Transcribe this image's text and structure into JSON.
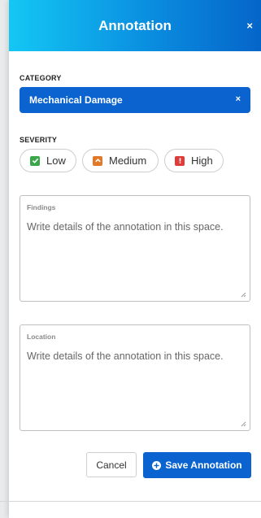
{
  "header": {
    "title": "Annotation",
    "close_glyph": "×"
  },
  "category": {
    "label": "CATEGORY",
    "selected": "Mechanical Damage",
    "clear_glyph": "×"
  },
  "severity": {
    "label": "SEVERITY",
    "options": [
      {
        "label": "Low",
        "icon": "check-icon",
        "color": "#3aa84a"
      },
      {
        "label": "Medium",
        "icon": "chevron-up-icon",
        "color": "#e07a2a"
      },
      {
        "label": "High",
        "icon": "exclamation-icon",
        "color": "#e03b3b"
      }
    ]
  },
  "findings": {
    "label": "Findings",
    "placeholder": "Write details of the annotation in this space."
  },
  "location": {
    "label": "Location",
    "placeholder": "Write details of the annotation in this space."
  },
  "actions": {
    "cancel": "Cancel",
    "save": "Save Annotation"
  },
  "colors": {
    "primary": "#0a63cf",
    "header_start": "#14c7f4",
    "header_end": "#0565c9"
  }
}
